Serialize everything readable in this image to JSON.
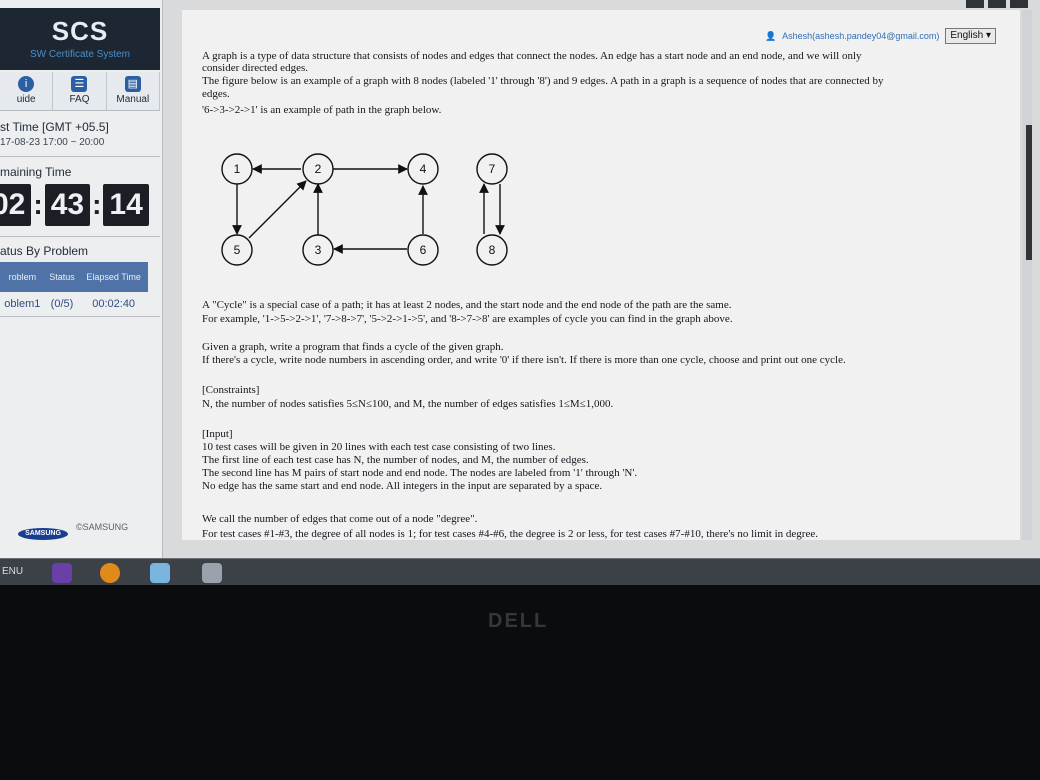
{
  "sidebar": {
    "logo": "SCS",
    "logo_sub": "SW Certificate System",
    "nav": [
      {
        "label": "uide",
        "icon": "info-icon"
      },
      {
        "label": "FAQ",
        "icon": "faq-icon"
      },
      {
        "label": "Manual",
        "icon": "manual-icon"
      }
    ],
    "test_time_label": "st Time [GMT +05.5]",
    "test_time_value": "17-08-23 17:00 ~ 20:00",
    "remaining_label": "maining Time",
    "timer": {
      "hours": "02",
      "minutes": "43",
      "seconds": "14"
    },
    "status_label": "atus By Problem",
    "status_headers": [
      "roblem",
      "Status",
      "Elapsed Time"
    ],
    "status_row": {
      "problem": "oblem1",
      "status": "(0/5)",
      "elapsed": "00:02:40"
    },
    "samsung_badge": "SAMSUNG",
    "samsung_copy": "©SAMSUNG"
  },
  "header": {
    "user": "Ashesh(ashesh.pandey04@gmail.com)",
    "language": "English"
  },
  "problem": {
    "lines": [
      "A graph is a type of data structure that consists of nodes and edges that connect the nodes. An edge has a start node and an end node, and we will only",
      "consider directed edges.",
      "The figure below is an example of a graph with 8 nodes (labeled '1' through '8') and 9 edges. A path in a graph is a sequence of nodes that are connected by",
      "edges.",
      "'6->3->2->1' is an example of path in the graph below.",
      "A \"Cycle\" is a special case of a path; it has at least 2 nodes, and the start node and the end node of the path are the same.",
      "For example, '1->5->2->1', '7->8->7', '5->2->1->5', and '8->7->8' are examples of cycle you can find in the graph above.",
      "Given a graph, write a program that finds a cycle of the given graph.",
      "If there's a cycle, write node numbers in ascending order, and write '0' if there isn't. If there is more than one cycle, choose and print out one cycle.",
      "[Constraints]",
      "N, the number of nodes satisfies 5≤N≤100, and M, the number of edges satisfies 1≤M≤1,000.",
      "[Input]",
      "10 test cases will be given in 20 lines with each test case consisting of two lines.",
      "The first line of each test case has N, the number of nodes, and M, the number of edges.",
      "The second line has M pairs of start node and end node. The nodes are labeled from '1' through 'N'.",
      "No edge has the same start and end node. All integers in the input are separated by a space.",
      "We call the number of edges that come out of a node \"degree\".",
      "For test cases #1-#3, the degree of all nodes is 1; for test cases #4-#6, the degree is 2 or less, for test cases #7-#10, there's no limit in degree."
    ],
    "graph_nodes": [
      "1",
      "2",
      "3",
      "4",
      "5",
      "6",
      "7",
      "8"
    ]
  },
  "taskbar": {
    "menu": "ENU"
  },
  "bezel": {
    "brand": "DELL"
  }
}
